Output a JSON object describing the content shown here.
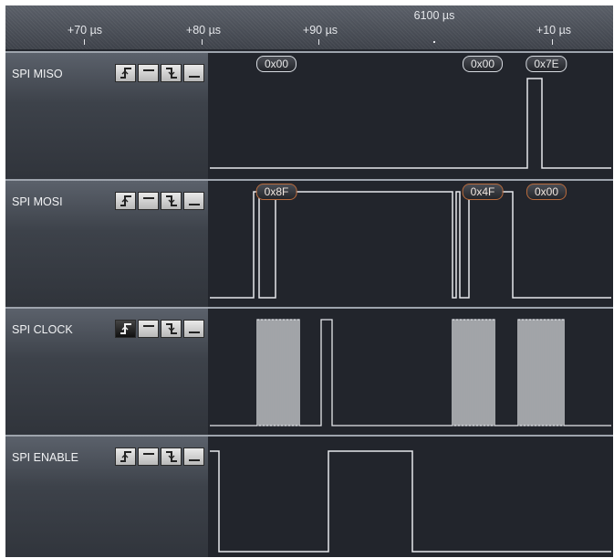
{
  "timeline": {
    "center_label": "6100 µs",
    "ticks": [
      {
        "label": "+70 µs"
      },
      {
        "label": "+80 µs"
      },
      {
        "label": "+90 µs"
      },
      {
        "label": "+10 µs"
      }
    ]
  },
  "channels": [
    {
      "name": "SPI MISO",
      "trigger_selected": "none",
      "decoded": [
        "0x00",
        "0x00",
        "0x7E"
      ]
    },
    {
      "name": "SPI MOSI",
      "trigger_selected": "none",
      "decoded": [
        "0x8F",
        "0x4F",
        "0x00"
      ]
    },
    {
      "name": "SPI CLOCK",
      "trigger_selected": "rising-edge",
      "decoded": []
    },
    {
      "name": "SPI ENABLE",
      "trigger_selected": "none",
      "decoded": []
    }
  ],
  "trigger_icons": [
    "rising-edge-icon",
    "high-level-icon",
    "falling-edge-icon",
    "low-level-icon"
  ],
  "colors": {
    "background": "#22252c",
    "waveform": "#e6e8ec",
    "badge_orange_border": "#b86a3c"
  }
}
